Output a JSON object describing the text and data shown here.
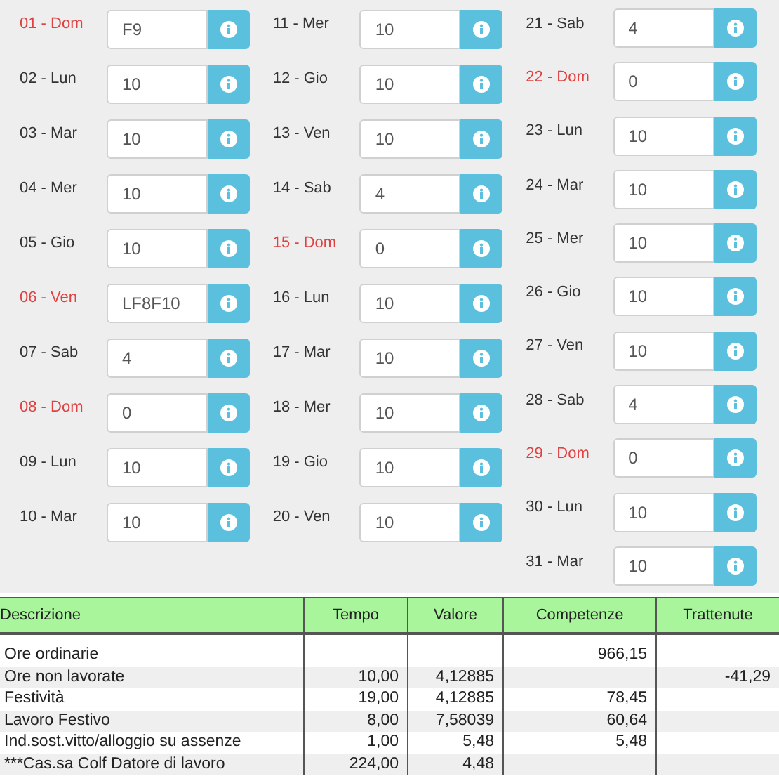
{
  "days_columns": [
    [
      {
        "label": "01 - Dom",
        "holiday": true,
        "value": "F9"
      },
      {
        "label": "02 - Lun",
        "holiday": false,
        "value": "10"
      },
      {
        "label": "03 - Mar",
        "holiday": false,
        "value": "10"
      },
      {
        "label": "04 - Mer",
        "holiday": false,
        "value": "10"
      },
      {
        "label": "05 - Gio",
        "holiday": false,
        "value": "10"
      },
      {
        "label": "06 - Ven",
        "holiday": true,
        "value": "LF8F10"
      },
      {
        "label": "07 - Sab",
        "holiday": false,
        "value": "4"
      },
      {
        "label": "08 - Dom",
        "holiday": true,
        "value": "0"
      },
      {
        "label": "09 - Lun",
        "holiday": false,
        "value": "10"
      },
      {
        "label": "10 - Mar",
        "holiday": false,
        "value": "10"
      }
    ],
    [
      {
        "label": "11 - Mer",
        "holiday": false,
        "value": "10"
      },
      {
        "label": "12 - Gio",
        "holiday": false,
        "value": "10"
      },
      {
        "label": "13 - Ven",
        "holiday": false,
        "value": "10"
      },
      {
        "label": "14 - Sab",
        "holiday": false,
        "value": "4"
      },
      {
        "label": "15 - Dom",
        "holiday": true,
        "value": "0"
      },
      {
        "label": "16 - Lun",
        "holiday": false,
        "value": "10"
      },
      {
        "label": "17 - Mar",
        "holiday": false,
        "value": "10"
      },
      {
        "label": "18 - Mer",
        "holiday": false,
        "value": "10"
      },
      {
        "label": "19 - Gio",
        "holiday": false,
        "value": "10"
      },
      {
        "label": "20 - Ven",
        "holiday": false,
        "value": "10"
      }
    ],
    [
      {
        "label": "21 - Sab",
        "holiday": false,
        "value": "4"
      },
      {
        "label": "22 - Dom",
        "holiday": true,
        "value": "0"
      },
      {
        "label": "23 - Lun",
        "holiday": false,
        "value": "10"
      },
      {
        "label": "24 - Mar",
        "holiday": false,
        "value": "10"
      },
      {
        "label": "25 - Mer",
        "holiday": false,
        "value": "10"
      },
      {
        "label": "26 - Gio",
        "holiday": false,
        "value": "10"
      },
      {
        "label": "27 - Ven",
        "holiday": false,
        "value": "10"
      },
      {
        "label": "28 - Sab",
        "holiday": false,
        "value": "4"
      },
      {
        "label": "29 - Dom",
        "holiday": true,
        "value": "0"
      },
      {
        "label": "30 - Lun",
        "holiday": false,
        "value": "10"
      },
      {
        "label": "31 - Mar",
        "holiday": false,
        "value": "10"
      }
    ]
  ],
  "table": {
    "columns": [
      "Descrizione",
      "Tempo",
      "Valore",
      "Competenze",
      "Trattenute"
    ],
    "rows": [
      {
        "descrizione": "Ore ordinarie",
        "competenze": "966,15"
      },
      {
        "descrizione": "Ore non lavorate",
        "tempo": "10,00",
        "valore": "4,12885",
        "trattenute": "-41,29"
      },
      {
        "descrizione": "Festività",
        "tempo": "19,00",
        "valore": "4,12885",
        "competenze": "78,45"
      },
      {
        "descrizione": "Lavoro Festivo",
        "tempo": "8,00",
        "valore": "7,58039",
        "competenze": "60,64"
      },
      {
        "descrizione": "Ind.sost.vitto/alloggio su assenze",
        "tempo": "1,00",
        "valore": "5,48",
        "competenze": "5,48"
      },
      {
        "descrizione": "***Cas.sa Colf Datore di lavoro",
        "tempo": "224,00",
        "valore": "4,48"
      }
    ]
  }
}
